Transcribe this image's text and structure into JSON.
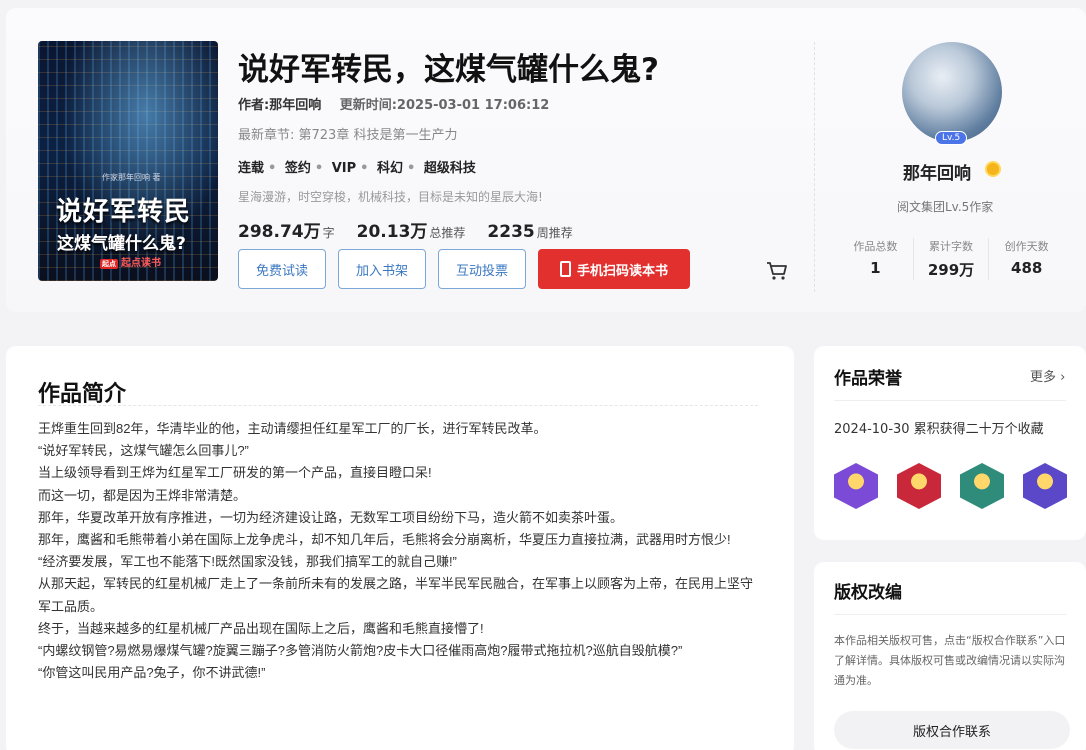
{
  "book": {
    "title": "说好军转民，这煤气罐什么鬼?",
    "author_line": "作者:那年回响",
    "updated_line": "更新时间:2025-03-01 17:06:12",
    "latest_chapter": "最新章节: 第723章 科技是第一生产力",
    "tags": [
      "连载",
      "签约",
      "VIP",
      "科幻",
      "超级科技"
    ],
    "slogan": "星海漫游，时空穿梭，机械科技，目标是未知的星辰大海!",
    "stats": [
      {
        "value": "298.74万",
        "unit": "字"
      },
      {
        "value": "20.13万",
        "unit": "总推荐"
      },
      {
        "value": "2235",
        "unit": "周推荐"
      }
    ],
    "cover": {
      "author": "作家那年回响 著",
      "title_line1": "说好军转民",
      "title_line2": "这煤气罐什么鬼?",
      "logo_badge": "起点",
      "logo_text": "起点读书"
    }
  },
  "buttons": {
    "trial": "免费试读",
    "shelf": "加入书架",
    "vote": "互动投票",
    "scan": "手机扫码读本书"
  },
  "author": {
    "level_badge": "Lv.5",
    "name": "那年回响",
    "title": "阅文集团Lv.5作家",
    "stats": [
      {
        "label": "作品总数",
        "value": "1"
      },
      {
        "label": "累计字数",
        "value": "299万"
      },
      {
        "label": "创作天数",
        "value": "488"
      }
    ]
  },
  "intro": {
    "heading": "作品简介",
    "paragraphs": [
      "王烨重生回到82年，华清毕业的他，主动请缨担任红星军工厂的厂长，进行军转民改革。",
      "“说好军转民，这煤气罐怎么回事儿?”",
      "当上级领导看到王烨为红星军工厂研发的第一个产品，直接目瞪口呆!",
      "而这一切，都是因为王烨非常清楚。",
      "那年，华夏改革开放有序推进，一切为经济建设让路，无数军工项目纷纷下马，造火箭不如卖茶叶蛋。",
      "那年，鹰酱和毛熊带着小弟在国际上龙争虎斗，却不知几年后，毛熊将会分崩离析，华夏压力直接拉满，武器用时方恨少!",
      "“经济要发展，军工也不能落下!既然国家没钱，那我们搞军工的就自己赚!”",
      "从那天起，军转民的红星机械厂走上了一条前所未有的发展之路，半军半民军民融合，在军事上以顾客为上帝，在民用上坚守军工品质。",
      "终于，当越来越多的红星机械厂产品出现在国际上之后，鹰酱和毛熊直接懵了!",
      "“内螺纹钢管?易燃易爆煤气罐?旋翼三蹦子?多管消防火箭炮?皮卡大口径催雨高炮?履带式拖拉机?巡航自毁航模?”",
      "“你管这叫民用产品?兔子，你不讲武德!”"
    ]
  },
  "honor": {
    "heading": "作品荣誉",
    "more": "更多",
    "item": "2024-10-30 累积获得二十万个收藏",
    "badge_colors": [
      "#7b4ad6",
      "#c8283a",
      "#2f8c7a",
      "#5a48c9"
    ]
  },
  "rights": {
    "heading": "版权改编",
    "text": "本作品相关版权可售，点击“版权合作联系”入口了解详情。具体版权可售或改编情况请以实际沟通为准。",
    "button": "版权合作联系"
  },
  "colors": {
    "accent_red": "#e2302f",
    "link_blue": "#3b78c2"
  }
}
